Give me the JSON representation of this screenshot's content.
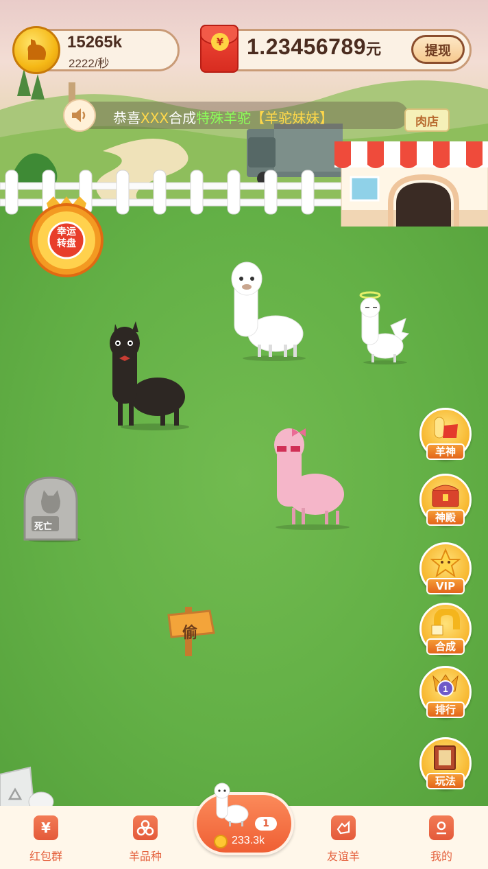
{
  "top_bar": {
    "coins": "15265k",
    "coin_rate": "2222/秒",
    "money": "1.23456789",
    "money_unit": "元",
    "withdraw_label": "提现"
  },
  "notice": {
    "prefix": "恭喜",
    "user": "XXX",
    "middle": "合成",
    "highlight": "特殊羊驼",
    "item": "【羊驼妹妹】"
  },
  "shop": {
    "sign": "肉店"
  },
  "lucky_wheel": {
    "line1": "幸运",
    "line2": "转盘"
  },
  "side_buttons": [
    {
      "label": "羊神",
      "icon": "sheep-god-icon"
    },
    {
      "label": "神殿",
      "icon": "temple-chest-icon"
    },
    {
      "label": "VIP",
      "icon": "vip-star-icon"
    },
    {
      "label": "合成",
      "icon": "merge-magnet-icon"
    },
    {
      "label": "排行",
      "icon": "rank-badge-icon"
    },
    {
      "label": "玩法",
      "icon": "rules-book-icon"
    }
  ],
  "field": {
    "tomb_label": "死亡",
    "steal_label": "偷"
  },
  "bottom_nav": {
    "items": [
      {
        "label": "红包群",
        "icon": "red-packet-icon"
      },
      {
        "label": "羊品种",
        "icon": "breeds-icon"
      },
      {
        "label": "友谊羊",
        "icon": "friendship-icon"
      },
      {
        "label": "我的",
        "icon": "profile-icon"
      }
    ],
    "buy": {
      "count": "1",
      "price": "233.3k"
    }
  },
  "colors": {
    "accent": "#e4613d",
    "grass": "#63b046",
    "gold": "#f7b52b"
  }
}
